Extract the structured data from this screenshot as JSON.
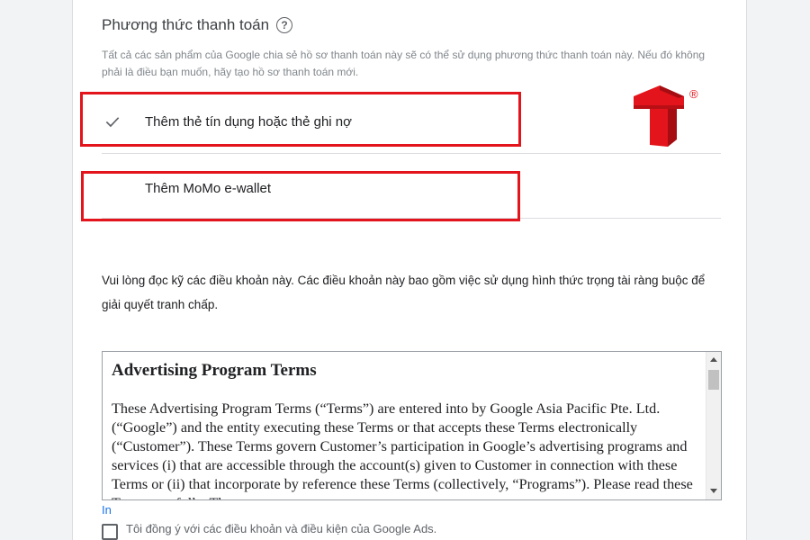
{
  "section": {
    "title": "Phương thức thanh toán",
    "help_icon": "help-circle-icon",
    "help_symbol": "?",
    "description": "Tất cả các sản phẩm của Google chia sẻ hồ sơ thanh toán này sẽ có thể sử dụng phương thức thanh toán này. Nếu đó không phải là điều bạn muốn, hãy tạo hồ sơ thanh toán mới."
  },
  "options": [
    {
      "label": "Thêm thẻ tín dụng hoặc thẻ ghi nợ",
      "selected": true,
      "icon": "checkmark-icon"
    },
    {
      "label": "Thêm MoMo e-wallet",
      "selected": false
    }
  ],
  "highlight_color": "#e3141b",
  "logo": {
    "registered": "®",
    "color": "#e3141b"
  },
  "terms_note": "Vui lòng đọc kỹ các điều khoản này. Các điều khoản này bao gồm việc sử dụng hình thức trọng tài ràng buộc để giải quyết tranh chấp.",
  "terms": {
    "heading": "Advertising Program Terms",
    "body": "These Advertising Program Terms (“Terms”) are entered into by Google Asia Pacific Pte. Ltd.  (“Google”) and the entity executing these Terms or that accepts these Terms electronically (“Customer”).  These Terms govern Customer’s participation in Google’s advertising programs and services (i) that are accessible through the account(s) given to Customer in connection with these Terms or (ii) that incorporate by reference these Terms (collectively, “Programs”). Please read these Terms carefully. These terms"
  },
  "print_link": "In",
  "agree_label": "Tôi đồng ý với các điều khoản và điều kiện của Google Ads.",
  "colors": {
    "link": "#1a73e8",
    "text": "#202124",
    "muted": "#80868b"
  }
}
